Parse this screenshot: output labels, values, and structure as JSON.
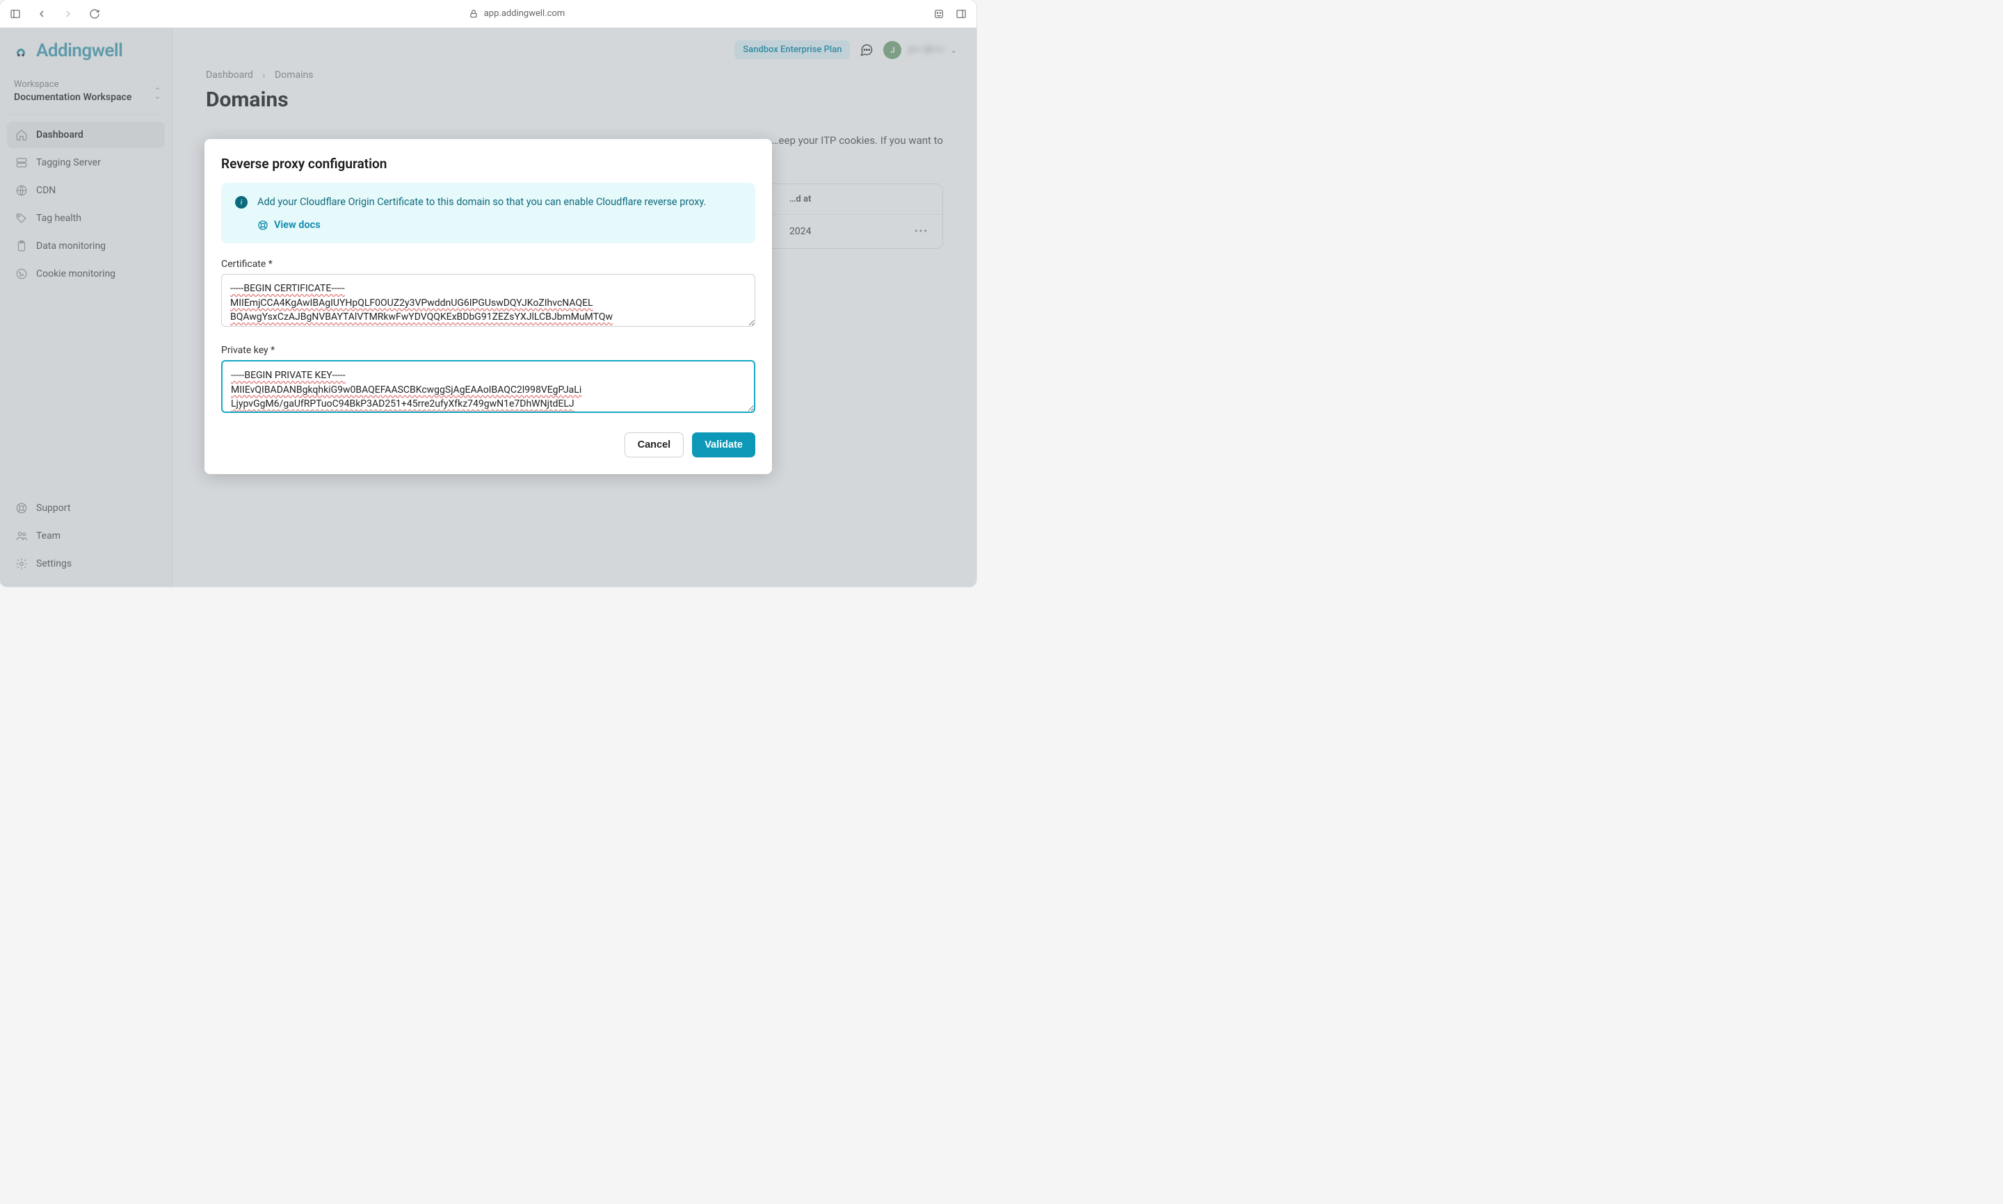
{
  "browser": {
    "url": "app.addingwell.com"
  },
  "brand": {
    "name": "Addingwell"
  },
  "workspace": {
    "label": "Workspace",
    "name": "Documentation Workspace"
  },
  "sidebar": {
    "items": [
      {
        "icon": "home",
        "label": "Dashboard",
        "active": true
      },
      {
        "icon": "server",
        "label": "Tagging Server",
        "active": false
      },
      {
        "icon": "globe",
        "label": "CDN",
        "active": false
      },
      {
        "icon": "tag",
        "label": "Tag health",
        "active": false
      },
      {
        "icon": "clipboard",
        "label": "Data monitoring",
        "active": false
      },
      {
        "icon": "cookie",
        "label": "Cookie monitoring",
        "active": false
      }
    ],
    "bottom": [
      {
        "icon": "lifebuoy",
        "label": "Support"
      },
      {
        "icon": "team",
        "label": "Team"
      },
      {
        "icon": "gear",
        "label": "Settings"
      }
    ]
  },
  "header": {
    "plan": "Sandbox Enterprise Plan",
    "avatar_initial": "J",
    "user_name_masked": "J••• D••••"
  },
  "breadcrumbs": {
    "root": "Dashboard",
    "current": "Domains"
  },
  "page": {
    "title": "Domains",
    "banner_partial": "…eep your ITP cookies. If you want to"
  },
  "table": {
    "col_created": "…d at",
    "row_date": "2024"
  },
  "modal": {
    "title": "Reverse proxy configuration",
    "info_text": "Add your Cloudflare Origin Certificate to this domain so that you can enable Cloudflare reverse proxy.",
    "view_docs": "View docs",
    "certificate_label": "Certificate *",
    "certificate_value": "-----BEGIN CERTIFICATE-----\nMIIEmjCCA4KgAwIBAgIUYHpQLF0OUZ2y3VPwddnUG6IPGUswDQYJKoZIhvcNAQEL\nBQAwgYsxCzAJBgNVBAYTAlVTMRkwFwYDVQQKExBDbG91ZEZsYXJlLCBJbmMuMTQw",
    "private_key_label": "Private key *",
    "private_key_value": "-----BEGIN PRIVATE KEY-----\nMIIEvQIBADANBgkqhkiG9w0BAQEFAASCBKcwggSjAgEAAoIBAQC2l998VEgPJaLi\nLjypvGgM6/gaUfRPTuoC94BkP3AD251+45rre2ufyXfkz749gwN1e7DhWNjtdELJ",
    "cancel": "Cancel",
    "validate": "Validate"
  }
}
